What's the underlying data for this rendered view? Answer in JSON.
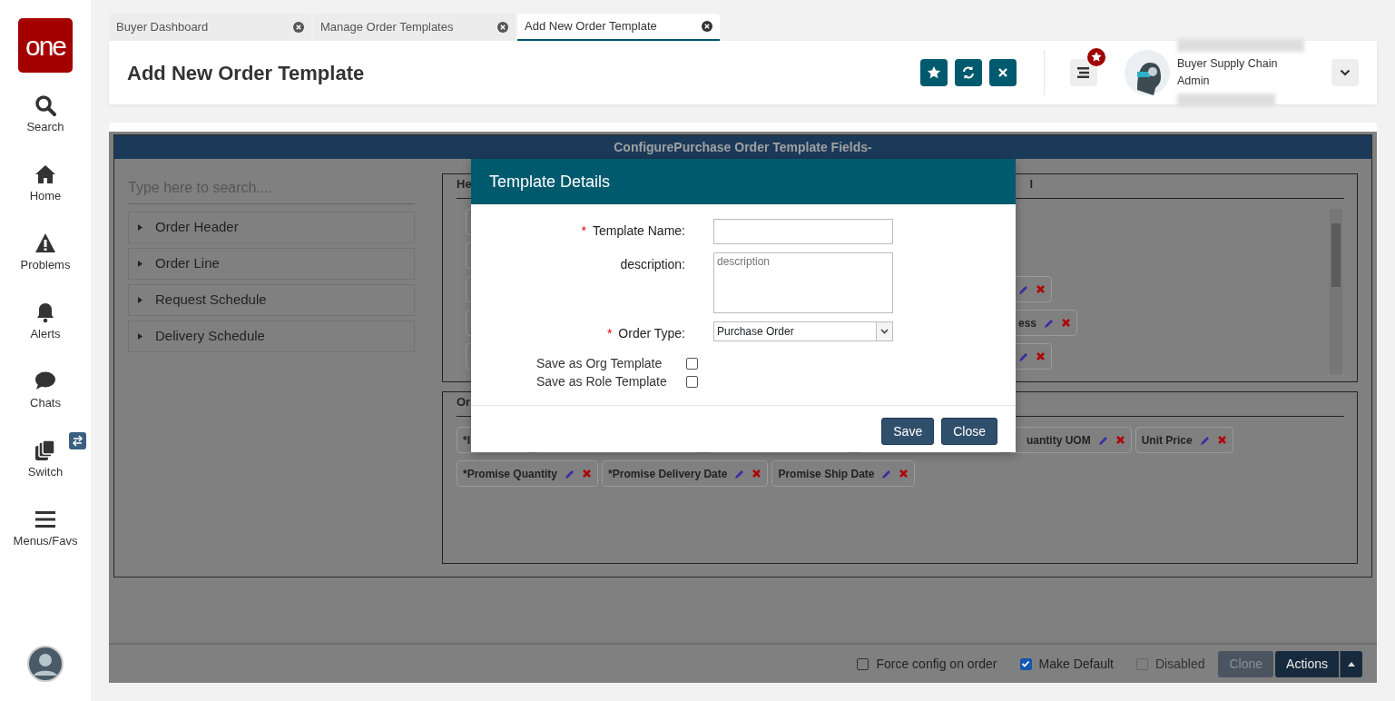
{
  "sidebar": {
    "logo": "one",
    "items": [
      {
        "label": "Search",
        "kind": "search"
      },
      {
        "label": "Home",
        "kind": "home"
      },
      {
        "label": "Problems",
        "kind": "problems"
      },
      {
        "label": "Alerts",
        "kind": "alerts"
      },
      {
        "label": "Chats",
        "kind": "chats"
      },
      {
        "label": "Switch",
        "kind": "switch"
      },
      {
        "label": "Menus/Favs",
        "kind": "menu"
      }
    ]
  },
  "tabs": [
    {
      "label": "Buyer Dashboard",
      "selected": false
    },
    {
      "label": "Manage Order Templates",
      "selected": false
    },
    {
      "label": "Add New Order Template",
      "selected": true
    }
  ],
  "header": {
    "title": "Add New Order Template",
    "user_role": "Buyer Supply Chain Admin"
  },
  "panel": {
    "title": "ConfigurePurchase Order Template Fields-",
    "search_placeholder": "Type here to search....",
    "tree": [
      "Order Header",
      "Order Line",
      "Request Schedule",
      "Delivery Schedule"
    ],
    "header_section": {
      "legend": "He",
      "legend_right": "l",
      "rows": [
        {
          "chips": [
            {
              "kind": "hidden"
            }
          ]
        },
        {
          "chips": [
            {
              "kind": "hidden"
            }
          ]
        },
        {
          "chips": [
            {
              "kind": "hidden"
            },
            {
              "kind": "tail"
            }
          ]
        },
        {
          "chips": [
            {
              "kind": "hidden"
            },
            {
              "kind": "tail",
              "label": "ess"
            }
          ]
        },
        {
          "chips": [
            {
              "kind": "hidden"
            },
            {
              "kind": "tail"
            }
          ]
        }
      ]
    },
    "order_section": {
      "legend": "Or",
      "rows": [
        {
          "chips": [
            {
              "kind": "head",
              "label": "*I"
            },
            {
              "kind": "hidden"
            },
            {
              "kind": "hidden"
            },
            {
              "kind": "hidden"
            },
            {
              "kind": "tail",
              "label": "uantity UOM"
            },
            {
              "kind": "field",
              "label": "Unit Price"
            }
          ]
        },
        {
          "chips": [
            {
              "kind": "field",
              "label": "*Promise Quantity"
            },
            {
              "kind": "field",
              "label": "*Promise Delivery Date"
            },
            {
              "kind": "field",
              "label": "Promise Ship Date"
            }
          ]
        }
      ]
    }
  },
  "dialog": {
    "title": "Template Details",
    "fields": [
      {
        "kind": "text",
        "label": "Template Name:",
        "required_mark": "*"
      },
      {
        "kind": "textarea",
        "label": "description:",
        "placeholder": "description"
      },
      {
        "kind": "select",
        "label": "Order Type:",
        "required_mark": "*",
        "value": "Purchase Order"
      }
    ],
    "options": [
      {
        "label": "Save as Org Template",
        "checked": false
      },
      {
        "label": "Save as Role Template",
        "checked": false
      }
    ],
    "buttons": [
      "Save",
      "Close"
    ]
  },
  "footer": {
    "options": [
      {
        "label": "Force config on order",
        "checked": false,
        "disabled": false
      },
      {
        "label": "Make Default",
        "checked": true,
        "disabled": false
      },
      {
        "label": "Disabled",
        "checked": false,
        "disabled": true
      }
    ],
    "buttons": [
      {
        "label": "Clone",
        "disabled": true
      },
      {
        "label": "Actions",
        "disabled": false
      }
    ]
  }
}
